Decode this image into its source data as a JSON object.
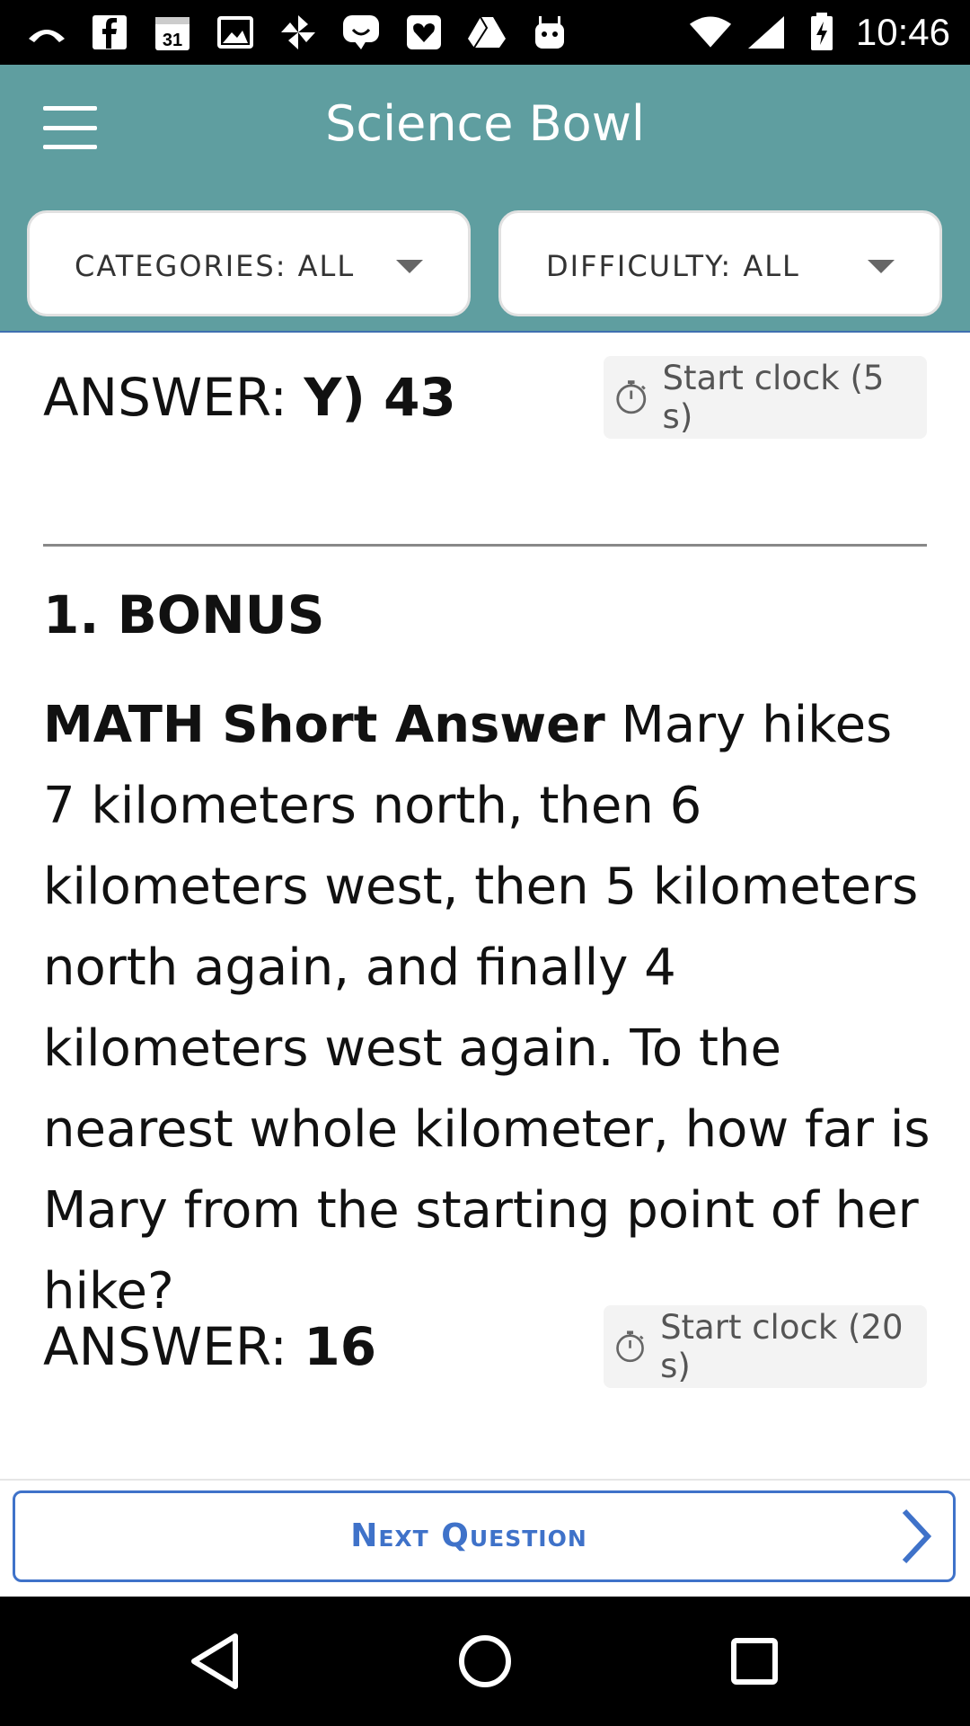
{
  "status_bar": {
    "time": "10:46",
    "calendar_day": "31",
    "icons": [
      "missed-call-icon",
      "facebook-icon",
      "calendar-icon",
      "image-icon",
      "pinwheel-icon",
      "chat-icon",
      "heart-icon",
      "drive-icon",
      "android-icon",
      "wifi-icon",
      "signal-icon",
      "battery-charging-icon"
    ]
  },
  "app_bar": {
    "title": "Science Bowl",
    "menu_icon": "hamburger-menu-icon"
  },
  "filters": {
    "categories_label": "CATEGORIES: ALL",
    "difficulty_label": "DIFFICULTY: ALL"
  },
  "tossup_answer": {
    "prefix": "ANSWER: ",
    "value": "Y) 43",
    "clock_label": "Start clock (5 s)"
  },
  "bonus": {
    "heading": "1. BONUS",
    "category_type": "MATH Short Answer",
    "question": " Mary hikes 7 kilometers north, then 6 kilometers west, then 5 kilometers north again, and finally 4 kilometers west again. To the nearest whole kilometer, how far is Mary from the starting point of her hike?",
    "answer_prefix": "ANSWER: ",
    "answer_value": "16",
    "clock_label": "Start clock (20 s)"
  },
  "next_button": {
    "label": "Next Question",
    "icon": "chevron-right-icon"
  },
  "colors": {
    "app_bar": "#5f9ea0",
    "accent": "#3f72c9"
  }
}
